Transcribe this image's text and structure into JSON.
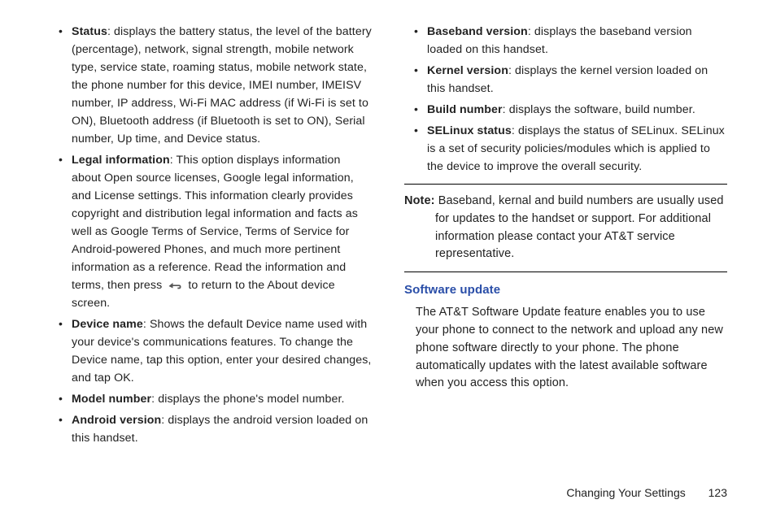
{
  "left": {
    "items": [
      {
        "term": "Status",
        "desc": ": displays the battery status, the level of the battery (percentage), network, signal strength, mobile network type, service state, roaming status, mobile network state, the phone number for this device, IMEI number, IMEISV number, IP address, Wi-Fi MAC address (if Wi-Fi is set to ON), Bluetooth address (if Bluetooth is set to ON), Serial number, Up time, and Device status."
      },
      {
        "term": "Legal information",
        "desc_before": ": This option displays information about Open source licenses, Google legal information, and License settings. This information clearly provides copyright and distribution legal information and facts as well as Google Terms of Service, Terms of Service for Android-powered Phones, and much more pertinent information as a reference. Read the information and terms, then press ",
        "desc_after": " to return to the About device screen."
      },
      {
        "term": "Device name",
        "desc": ": Shows the default Device name used with your device's communications features. To change the Device name, tap this option, enter your desired changes, and tap OK."
      },
      {
        "term": "Model number",
        "desc": ": displays the phone's model number."
      },
      {
        "term": "Android version",
        "desc": ": displays the android version loaded on this handset."
      }
    ]
  },
  "right": {
    "items": [
      {
        "term": "Baseband version",
        "desc": ": displays the baseband version loaded on this handset."
      },
      {
        "term": "Kernel version",
        "desc": ": displays the kernel version loaded on this handset."
      },
      {
        "term": "Build number",
        "desc": ": displays the software, build number."
      },
      {
        "term": "SELinux status",
        "desc": ": displays the status of SELinux. SELinux is a set of security policies/modules which is applied to the device to improve the overall security."
      }
    ],
    "note_label": "Note:",
    "note_text": " Baseband, kernal and build numbers are usually used for updates to the handset or support. For additional information please contact your AT&T service representative.",
    "heading": "Software update",
    "para": "The AT&T Software Update feature enables you to use your phone to connect to the network and upload any new phone software directly to your phone. The phone automatically updates with the latest available software when you access this option."
  },
  "footer": {
    "section": "Changing Your Settings",
    "page": "123"
  }
}
